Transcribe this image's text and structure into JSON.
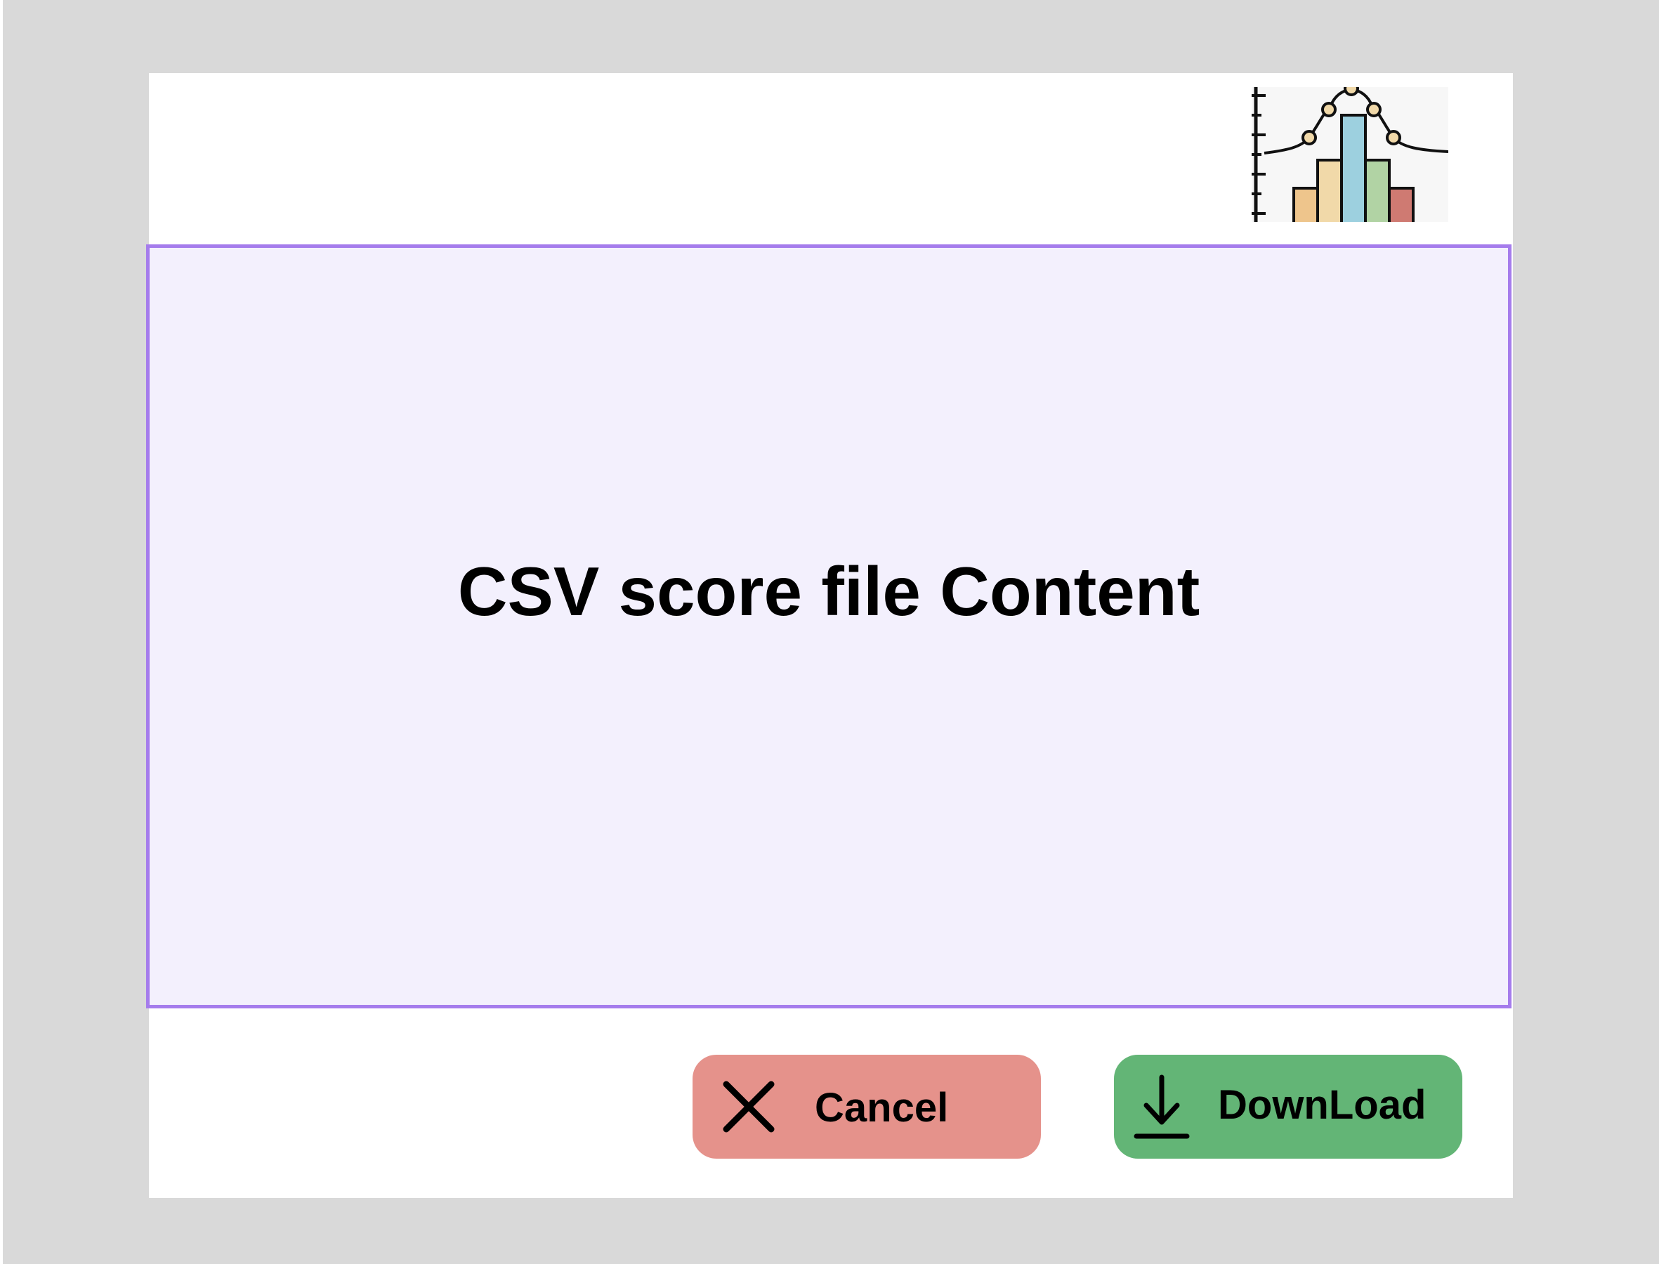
{
  "content": {
    "title": "CSV score file Content"
  },
  "buttons": {
    "cancel_label": "Cancel",
    "download_label": "DownLoad"
  },
  "icons": {
    "logo": "histogram-bell-curve-icon",
    "cancel": "close-x-icon",
    "download": "download-icon"
  },
  "colors": {
    "background": "#d9d9d9",
    "panel_border": "#a57cec",
    "panel_fill": "#f3f0fd",
    "cancel_button": "#e5928b",
    "download_button": "#63b576"
  }
}
